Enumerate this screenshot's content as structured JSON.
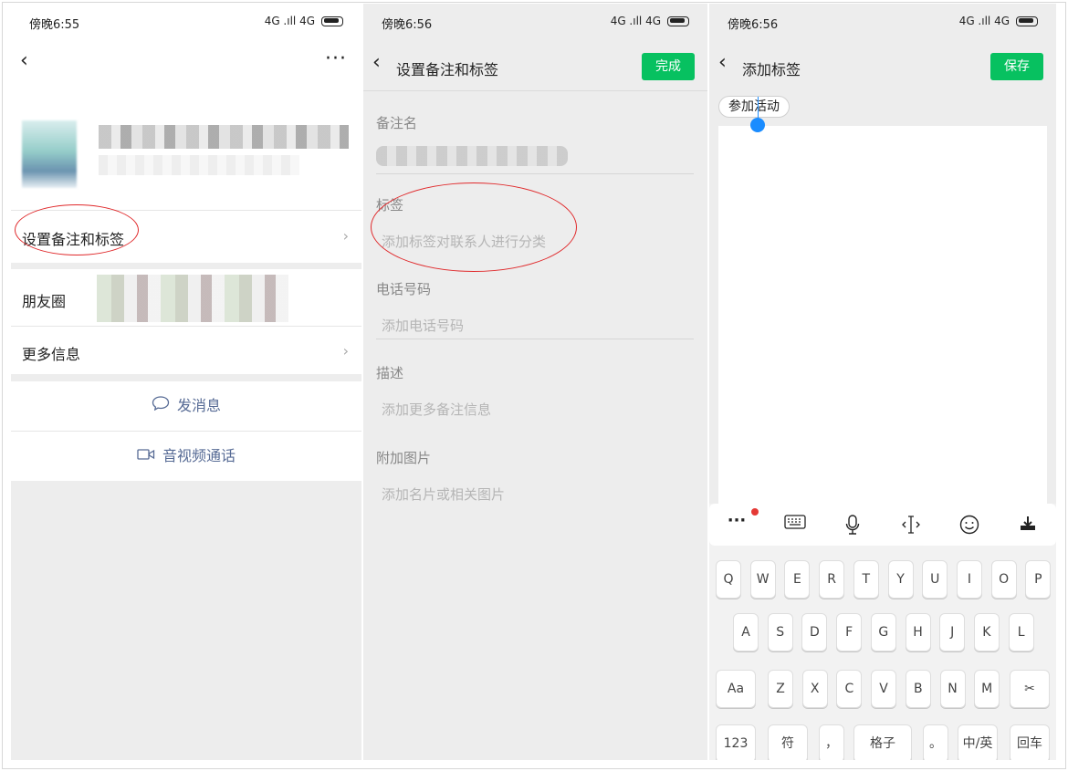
{
  "panel1": {
    "time": "傍晚6:55",
    "signal": "4G .ıll 4G",
    "remark_tag_row": "设置备注和标签",
    "moments_row": "朋友圈",
    "more_info_row": "更多信息",
    "send_message": "发消息",
    "video_call": "音视频通话"
  },
  "panel2": {
    "time": "傍晚6:56",
    "signal": "4G .ıll 4G",
    "title": "设置备注和标签",
    "done_button": "完成",
    "remark_label": "备注名",
    "tag_label": "标签",
    "tag_placeholder": "添加标签对联系人进行分类",
    "phone_label": "电话号码",
    "phone_placeholder": "添加电话号码",
    "desc_label": "描述",
    "desc_placeholder": "添加更多备注信息",
    "image_label": "附加图片",
    "image_placeholder": "添加名片或相关图片"
  },
  "panel3": {
    "time": "傍晚6:56",
    "signal": "4G .ıll 4G",
    "title": "添加标签",
    "save_button": "保存",
    "tag_chip": "参加活动",
    "keyboard": {
      "row1": [
        "Q",
        "W",
        "E",
        "R",
        "T",
        "Y",
        "U",
        "I",
        "O",
        "P"
      ],
      "row2": [
        "A",
        "S",
        "D",
        "F",
        "G",
        "H",
        "J",
        "K",
        "L"
      ],
      "row3": [
        "Aa",
        "Z",
        "X",
        "C",
        "V",
        "B",
        "N",
        "M",
        "✂"
      ],
      "row4": [
        "123",
        "符",
        "，",
        "格子",
        "。",
        "中/英",
        "回车"
      ]
    }
  },
  "colors": {
    "accent_green": "#07c160",
    "link_blue": "#576b95",
    "annotation_red": "#e0292b",
    "cursor_blue": "#1a8cff"
  },
  "icons": [
    "back-chevron-icon",
    "more-dots-icon",
    "chevron-right-icon",
    "message-bubble-icon",
    "video-camera-icon",
    "keyboard-icon",
    "microphone-icon",
    "cursor-icon",
    "emoji-icon",
    "hide-keyboard-icon",
    "scissors-icon"
  ]
}
